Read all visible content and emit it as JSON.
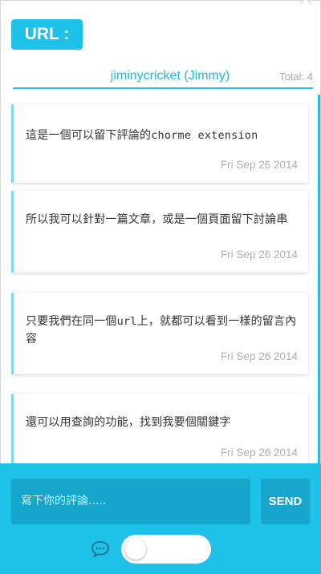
{
  "header": {
    "url_label": "URL :",
    "user": "jiminycricket (Jimmy)",
    "total": "Total: 4"
  },
  "comments": [
    {
      "text_zh": "這是一個可以留下評論的",
      "text_code": "chorme extension",
      "text_tail": "",
      "date": "Fri Sep 26 2014"
    },
    {
      "text_zh": "所以我可以針對一篇文章，或是一個頁面留下討論串",
      "text_code": "",
      "text_tail": "",
      "date": "Fri Sep 26 2014"
    },
    {
      "text_zh": "只要我們在同一個",
      "text_code": "url",
      "text_tail": "上，就都可以看到一樣的留言內容",
      "date": "Fri Sep 26 2014"
    },
    {
      "text_zh": "還可以用查詢的功能，找到我要個關鍵字",
      "text_code": "",
      "text_tail": "",
      "date": "Fri Sep 26 2014"
    }
  ],
  "composer": {
    "placeholder": "寫下你的評論.....",
    "send_label": "SEND"
  },
  "toggle": {
    "state": "off"
  },
  "colors": {
    "accent": "#1ec2e8",
    "accent_dark": "#16a6cc",
    "card_edge": "#7fd6f0",
    "date": "#b0b0b0"
  },
  "icons": [
    "chat-bubble-icon"
  ]
}
